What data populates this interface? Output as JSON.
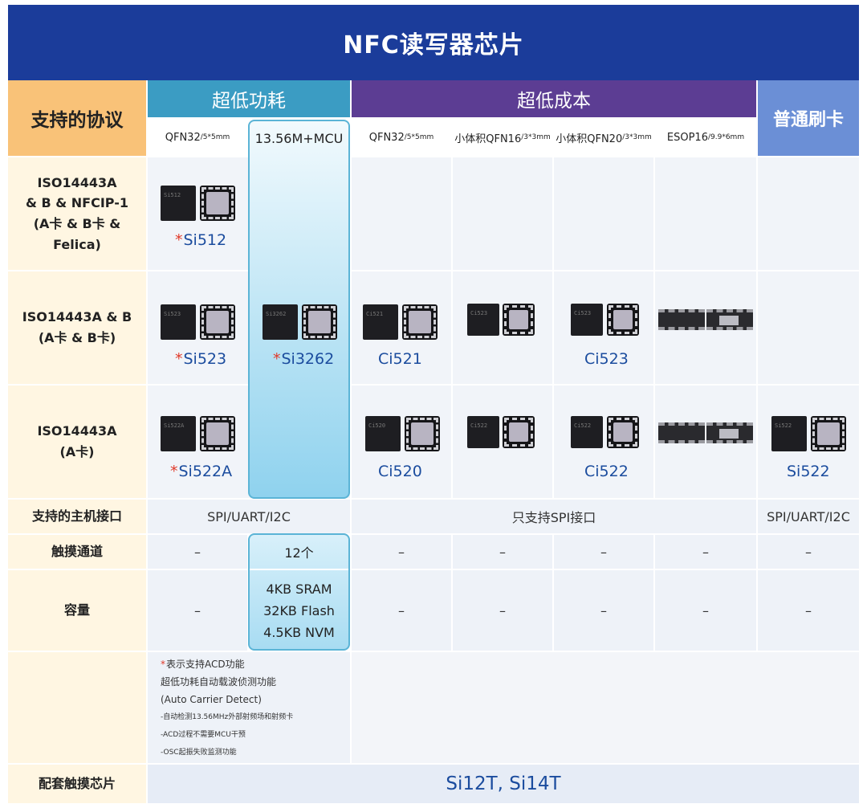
{
  "title": "NFC读写器芯片",
  "header": {
    "left": "支持的协议",
    "groups": [
      "超低功耗",
      "超低成本",
      "普通刷卡"
    ],
    "sub": [
      {
        "main": "QFN32",
        "small": "/5*5mm"
      },
      {
        "main": "13.56M+MCU",
        "small": ""
      },
      {
        "main": "QFN32",
        "small": "/5*5mm"
      },
      {
        "main": "小体积QFN16",
        "small": "/3*3mm"
      },
      {
        "main": "小体积QFN20",
        "small": "/3*3mm"
      },
      {
        "main": "ESOP16",
        "small": "/9.9*6mm"
      }
    ]
  },
  "rows": {
    "r1_label": [
      "ISO14443A",
      "& B & NFCIP-1",
      "(A卡 & B卡 & Felica)"
    ],
    "r2_label": [
      "ISO14443A & B",
      "(A卡 & B卡)"
    ],
    "r3_label": [
      "ISO14443A",
      "(A卡)"
    ]
  },
  "chips": {
    "si512": "Si512",
    "si523": "Si523",
    "si3262": "Si3262",
    "ci521": "Ci521",
    "ci523": "Ci523",
    "si522a": "Si522A",
    "ci520": "Ci520",
    "ci522": "Ci522",
    "si522": "Si522",
    "star": "*"
  },
  "chip_marks": {
    "m512": "Si512",
    "m523": "Si523",
    "m3262": "Si3262",
    "m521": "Ci521",
    "m523c": "Ci523",
    "m522a": "Si522A",
    "m520": "Ci520",
    "m522c": "Ci522",
    "m522": "Si522"
  },
  "interface": {
    "label": "支持的主机接口",
    "low_power": "SPI/UART/I2C",
    "low_cost": "只支持SPI接口",
    "normal": "SPI/UART/I2C"
  },
  "touch": {
    "label": "触摸通道",
    "mcu": "12个",
    "dash": "–"
  },
  "capacity": {
    "label": "容量",
    "mcu": [
      "4KB SRAM",
      "32KB Flash",
      "4.5KB NVM"
    ],
    "dash": "–"
  },
  "notes": {
    "star": "*",
    "l1": "表示支持ACD功能",
    "l2": "超低功耗自动载波侦测功能",
    "l3": "(Auto Carrier Detect)",
    "l4": "-自动检测13.56MHz外部射频场和射频卡",
    "l5": "-ACD过程不需要MCU干预",
    "l6": "-OSC起振失败监测功能"
  },
  "footer": {
    "label": "配套触摸芯片",
    "value": "Si12T, Si14T"
  },
  "colors": {
    "title_bg": "#1b3c9a",
    "low_power": "#3b9cc3",
    "low_cost": "#5c3d93",
    "normal": "#6b8fd6",
    "label_bg": "#f9c278"
  }
}
